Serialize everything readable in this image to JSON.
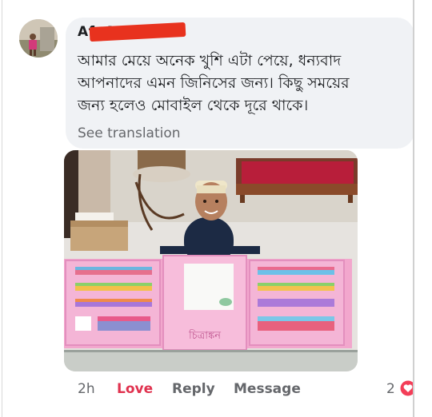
{
  "comment": {
    "author": "Afr      Mirkira",
    "text_lines": [
      "আমার মেয়ে অনেক খুশি এটা পেয়ে, ধন্যবাদ",
      "আপনাদের এমন জিনিসের জন্য। কিছু সময়ের",
      "জন্য হলেও মোবাইল থেকে দূরে থাকে।"
    ],
    "see_translation": "See translation"
  },
  "actions": {
    "time": "2h",
    "reaction": "Love",
    "reply": "Reply",
    "message": "Message",
    "reaction_count": "2",
    "reaction_icon": "heart-icon"
  },
  "colors": {
    "bubble": "#f0f2f5",
    "love": "#e0314e",
    "muted": "#65676b",
    "text": "#1c1e21"
  },
  "photo": {
    "box_label": "চিত্রাঙ্কন"
  }
}
